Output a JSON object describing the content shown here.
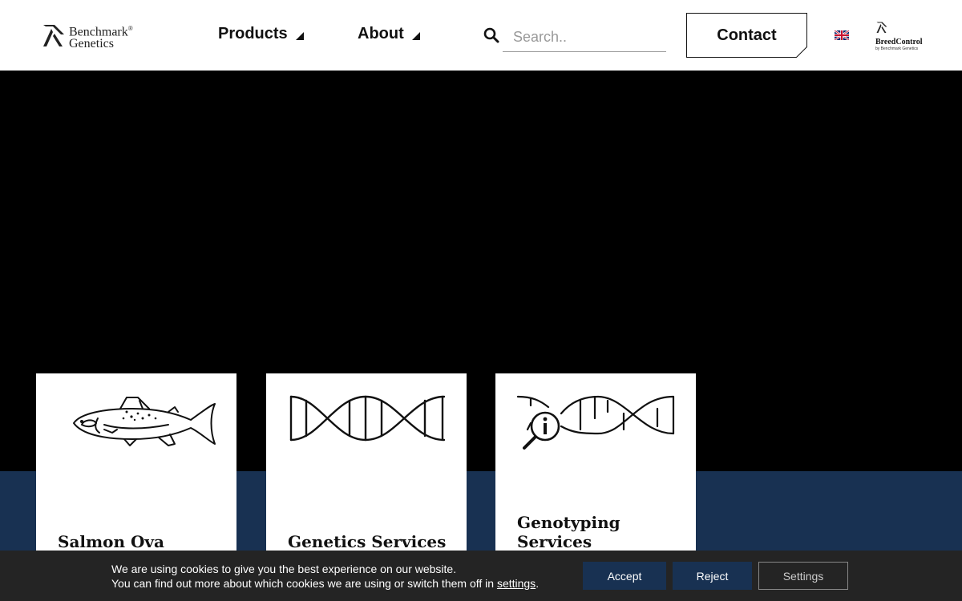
{
  "header": {
    "logo_line1": "Benchmark",
    "logo_line2": "Genetics",
    "logo_mark": "®",
    "nav": [
      {
        "label": "Products",
        "icon": "triangle-down-icon"
      },
      {
        "label": "About",
        "icon": "triangle-down-icon"
      }
    ],
    "search": {
      "placeholder": "Search..",
      "value": "",
      "icon": "search-icon"
    },
    "contact_label": "Contact",
    "language_flag": "uk-flag-icon",
    "breedcontrol_title": "BreedControl",
    "breedcontrol_sub": "by Benchmark Genetics"
  },
  "hero": {
    "background": "#000000"
  },
  "cards": [
    {
      "title": "Salmon Ova",
      "icon": "salmon-icon"
    },
    {
      "title": "Genetics Services",
      "icon": "dna-icon"
    },
    {
      "title": "Genotyping Services",
      "icon": "dna-magnifier-icon"
    }
  ],
  "cookie": {
    "line1": "We are using cookies to give you the best experience on our website.",
    "line2_prefix": "You can find out more about which cookies we are using or switch them off in ",
    "line2_link": "settings",
    "line2_suffix": ".",
    "accept_label": "Accept",
    "reject_label": "Reject",
    "settings_label": "Settings"
  },
  "colors": {
    "navy": "#183152",
    "cookie_bg": "#242424",
    "hero_bg": "#000000",
    "text_dark": "#111111"
  }
}
